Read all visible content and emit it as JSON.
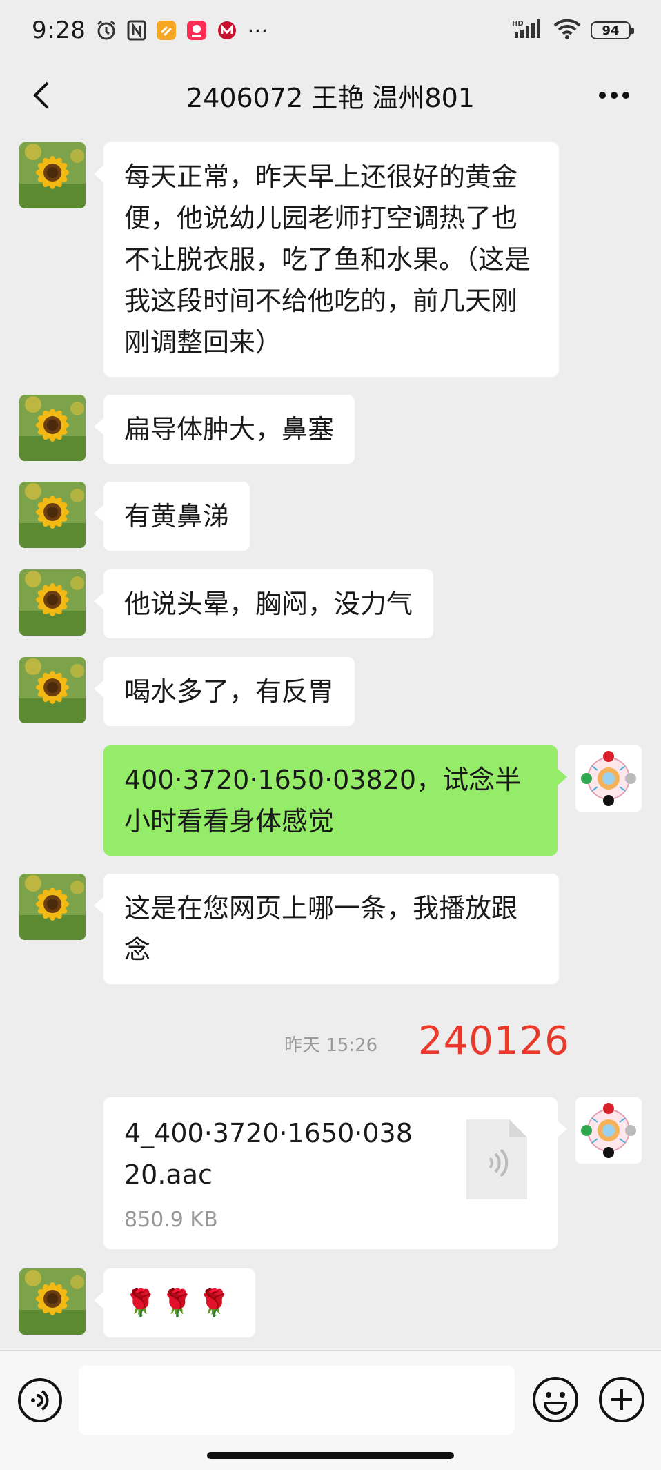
{
  "status_bar": {
    "time": "9:28",
    "hd_label": "HD",
    "battery": "94",
    "more_icon": "⋯"
  },
  "header": {
    "title": "2406072 王艳 温州801"
  },
  "messages": [
    {
      "side": "left",
      "text": "每天正常，昨天早上还很好的黄金便，他说幼儿园老师打空调热了也不让脱衣服，吃了鱼和水果。（这是我这段时间不给他吃的，前几天刚刚调整回来）"
    },
    {
      "side": "left",
      "text": "扁导体肿大，鼻塞"
    },
    {
      "side": "left",
      "text": "有黄鼻涕"
    },
    {
      "side": "left",
      "text": "他说头晕，胸闷，没力气"
    },
    {
      "side": "left",
      "text": "喝水多了，有反胃"
    },
    {
      "side": "right",
      "text": "400·3720·1650·03820，试念半小时看看身体感觉"
    },
    {
      "side": "left",
      "text": "这是在您网页上哪一条，我播放跟念"
    }
  ],
  "timestamp": "昨天 15:26",
  "annotation_number": "240126",
  "file_message": {
    "name": "4_400·3720·1650·03820.aac",
    "size": "850.9 KB"
  },
  "last_message": {
    "side": "left",
    "text": "🌹🌹🌹"
  },
  "colors": {
    "background": "#ededed",
    "sent_bubble": "#95ec69",
    "received_bubble": "#ffffff",
    "annotation": "#e8392a"
  }
}
